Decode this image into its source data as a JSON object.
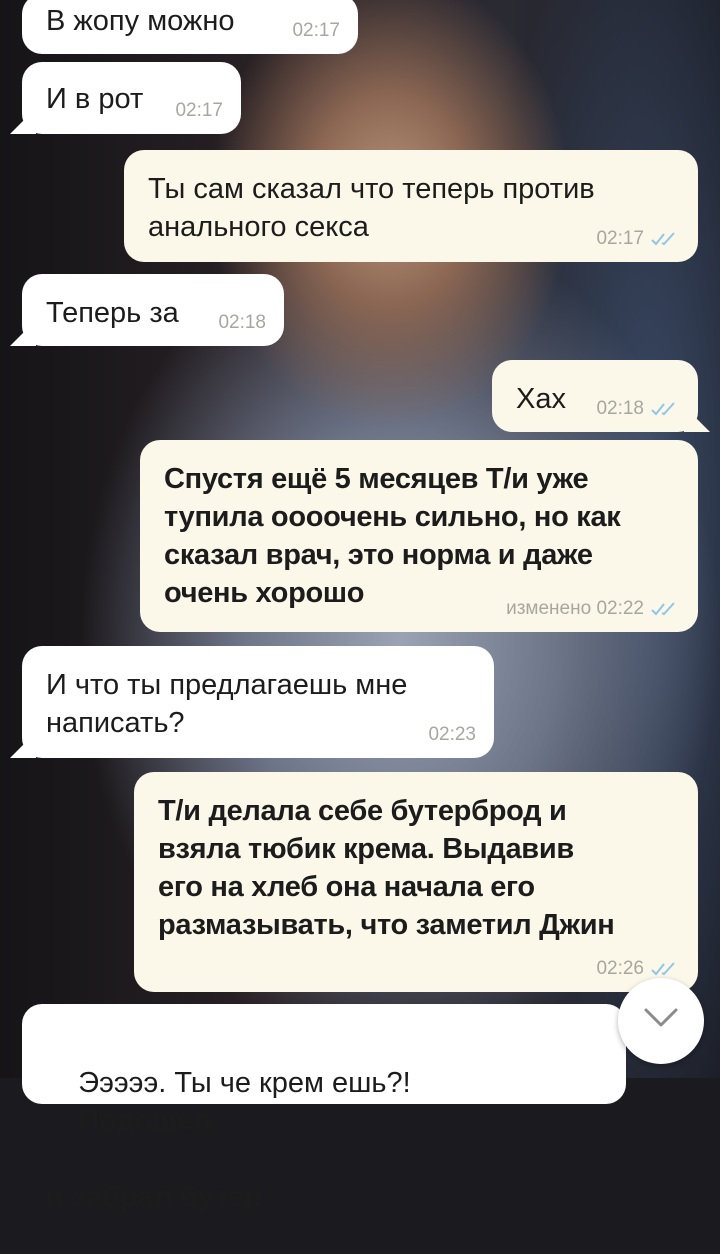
{
  "messages": [
    {
      "id": "m1",
      "dir": "in",
      "text": "В жопу можно",
      "time": "02:17"
    },
    {
      "id": "m2",
      "dir": "in",
      "text": "И в рот",
      "time": "02:17"
    },
    {
      "id": "m3",
      "dir": "out",
      "text": "Ты сам сказал что теперь против\nанального секса",
      "time": "02:17",
      "status": "read"
    },
    {
      "id": "m4",
      "dir": "in",
      "text": "Теперь за",
      "time": "02:18"
    },
    {
      "id": "m5",
      "dir": "out",
      "text": "Хах",
      "time": "02:18",
      "status": "read"
    },
    {
      "id": "m6",
      "dir": "out",
      "text": "Спустя ещё 5 месяцев Т/и уже\nтупила оооочень сильно, но как\nсказал врач, это норма и даже\nочень хорошо",
      "time": "02:22",
      "edited_label": "изменено",
      "status": "read",
      "bold": true
    },
    {
      "id": "m7",
      "dir": "in",
      "text": "И что ты предлагаешь мне\nнаписать?",
      "time": "02:23"
    },
    {
      "id": "m8",
      "dir": "out",
      "text": "Т/и делала себе бутерброд и\nвзяла тюбик крема. Выдавив\nего на хлеб она начала его\nразмазывать, что заметил Джин",
      "time": "02:26",
      "status": "read",
      "bold": true
    },
    {
      "id": "m9",
      "dir": "in",
      "text": "Эээээ. Ты че крем ешь?!",
      "text_bold": "Подошёл",
      "text_cut": "и забрал бутер"
    }
  ],
  "colors": {
    "incoming": "#ffffff",
    "outgoing": "#fbf8e9",
    "read_check": "#8fc6e8",
    "meta": "#a7a7a0"
  },
  "icons": {
    "scroll_down": "chevron-down-icon",
    "read": "double-check-icon"
  }
}
